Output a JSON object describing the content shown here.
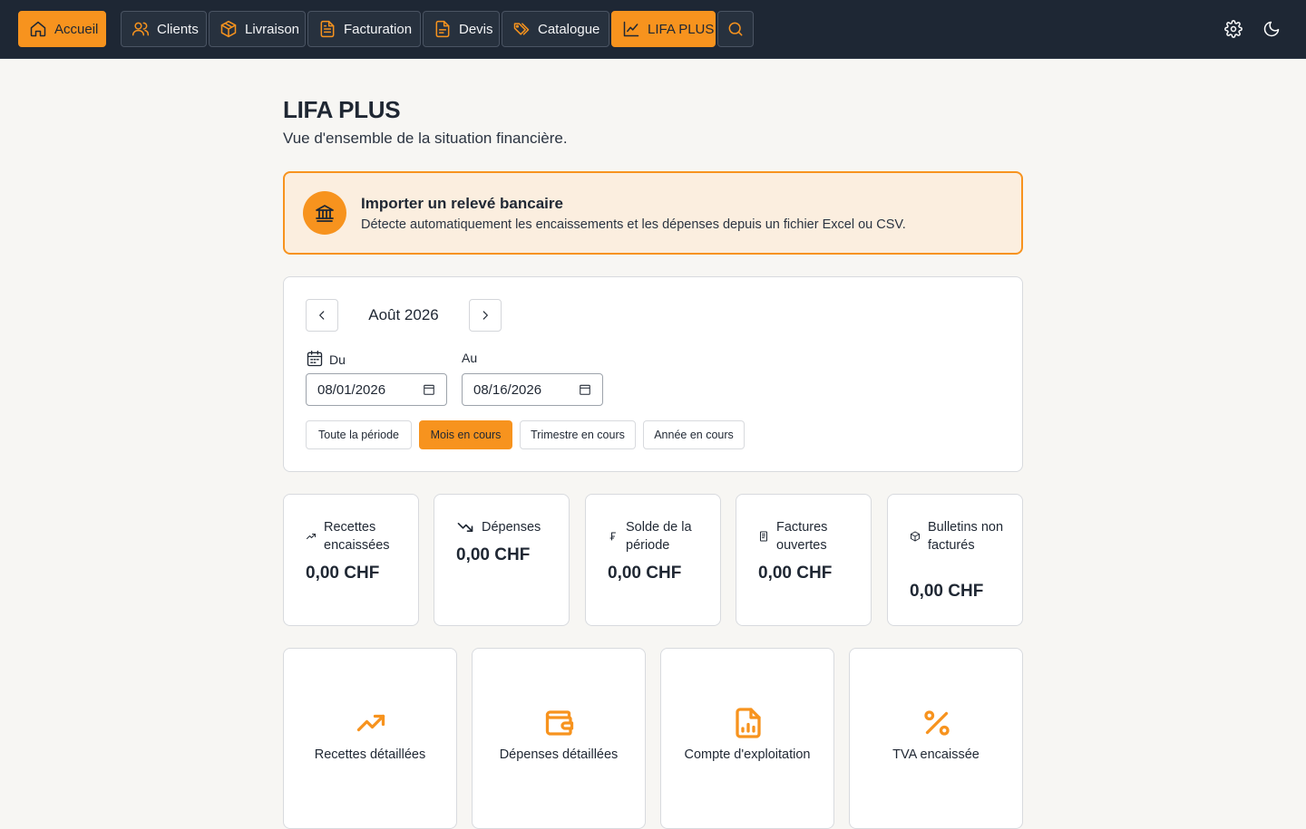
{
  "nav": {
    "items": [
      {
        "label": "Accueil",
        "icon": "home-icon"
      },
      {
        "label": "Clients",
        "icon": "users-icon"
      },
      {
        "label": "Livraison",
        "icon": "package-icon"
      },
      {
        "label": "Facturation",
        "icon": "invoice-icon"
      },
      {
        "label": "Devis",
        "icon": "document-icon"
      },
      {
        "label": "Catalogue",
        "icon": "tags-icon"
      },
      {
        "label": "LIFA PLUS",
        "icon": "chart-line-icon"
      }
    ],
    "search_icon": "search-icon",
    "settings_icon": "gear-icon",
    "theme_icon": "moon-icon"
  },
  "page": {
    "title": "LIFA PLUS",
    "subtitle": "Vue d'ensemble de la situation financière."
  },
  "import_banner": {
    "title": "Importer un relevé bancaire",
    "description": "Détecte automatiquement les encaissements et les dépenses depuis un fichier Excel ou CSV.",
    "icon": "bank-icon"
  },
  "period": {
    "month_label": "Août 2026",
    "from_label": "Du",
    "to_label": "Au",
    "from_value": "08/01/2026",
    "to_value": "08/16/2026",
    "presets": [
      "Toute la période",
      "Mois en cours",
      "Trimestre en cours",
      "Année en cours"
    ],
    "active_preset": "Mois en cours"
  },
  "stats": [
    {
      "label": "Recettes encaissées",
      "value": "0,00 CHF",
      "icon": "trend-up-icon"
    },
    {
      "label": "Dépenses",
      "value": "0,00 CHF",
      "icon": "trend-down-icon"
    },
    {
      "label": "Solde de la période",
      "value": "0,00 CHF",
      "icon": "franc-icon"
    },
    {
      "label": "Factures ouvertes",
      "value": "0,00 CHF",
      "icon": "receipt-icon"
    },
    {
      "label": "Bulletins non facturés",
      "value": "0,00 CHF",
      "icon": "package-icon"
    }
  ],
  "reports": [
    {
      "label": "Recettes détaillées",
      "icon": "trend-up-icon"
    },
    {
      "label": "Dépenses détaillées",
      "icon": "wallet-icon"
    },
    {
      "label": "Compte d'exploitation",
      "icon": "report-chart-icon"
    },
    {
      "label": "TVA encaissée",
      "icon": "percent-icon"
    }
  ],
  "colors": {
    "accent": "#f7931e",
    "topbar": "#1e2734",
    "background": "#f7f6f3"
  }
}
